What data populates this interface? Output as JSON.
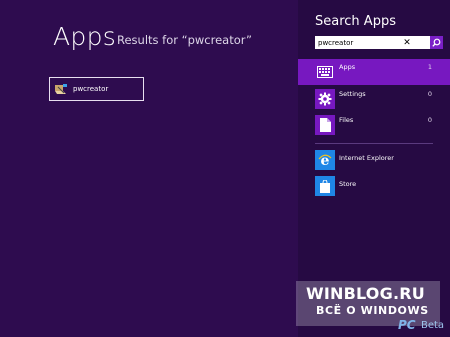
{
  "main": {
    "title": "Apps",
    "subtitle": "Results for “pwcreator”",
    "results": [
      {
        "label": "pwcreator",
        "icon": "pwcreator-app-icon"
      }
    ]
  },
  "search_pane": {
    "title": "Search Apps",
    "query": "pwcreator",
    "clear_icon": "close-icon",
    "go_icon": "search-icon",
    "scopes": [
      {
        "label": "Apps",
        "count": "1",
        "icon": "keyboard-icon",
        "active": true
      },
      {
        "label": "Settings",
        "count": "0",
        "icon": "gear-icon",
        "active": false
      },
      {
        "label": "Files",
        "count": "0",
        "icon": "file-icon",
        "active": false
      }
    ],
    "apps": [
      {
        "label": "Internet Explorer",
        "icon": "internet-explorer-icon"
      },
      {
        "label": "Store",
        "icon": "store-icon"
      }
    ]
  },
  "watermark": {
    "site": "WINBLOG.RU",
    "tagline": "ВСЁ О WINDOWS",
    "brand": "PC",
    "beta": "Beta"
  },
  "colors": {
    "background": "#2e0c4f",
    "pane": "#260a43",
    "accent": "#7718c0",
    "tile_blue": "#1f86e6"
  }
}
